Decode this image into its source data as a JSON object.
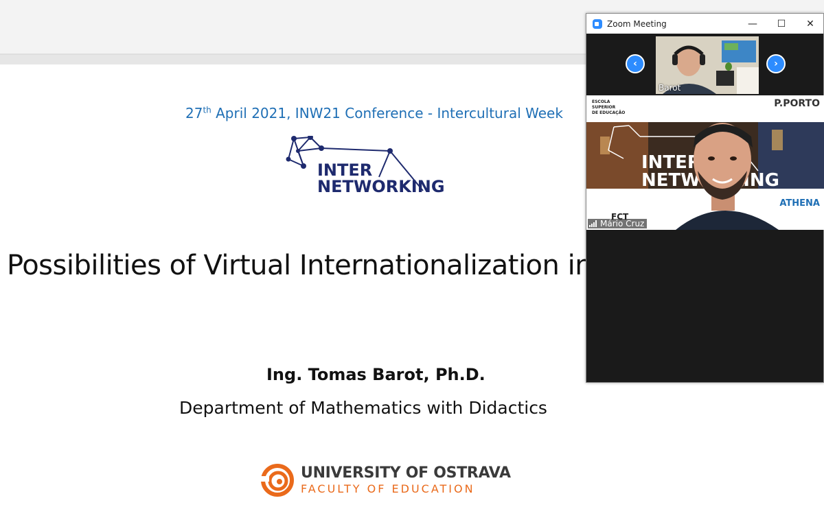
{
  "slide": {
    "conference_ordinal_number": "27",
    "conference_ordinal_suffix": "th",
    "conference_rest": " April 2021, INW21 Conference - Intercultural Week",
    "logo_line1": "INTER",
    "logo_line2": "NETWORKING",
    "title": "Possibilities of Virtual Internationalization in",
    "author": "Ing. Tomas Barot, Ph.D.",
    "department": "Department of Mathematics with Didactics",
    "university_name": "UNIVERSITY OF OSTRAVA",
    "faculty_name": "FACULTY OF EDUCATION"
  },
  "zoom": {
    "window_title": "Zoom Meeting",
    "minimize_glyph": "—",
    "maximize_glyph": "☐",
    "close_glyph": "✕",
    "prev_glyph": "‹",
    "next_glyph": "›",
    "thumbnail_name": "Barot",
    "main_name": "Mário Cruz",
    "banner": {
      "escola": "ESCOLA\nSUPERIOR\nDE EDUCAÇÃO",
      "porto": "P.PORTO",
      "athena": "ATHENA",
      "fct": "FCT",
      "title_line1": "INTER",
      "title_line2": "NETWORKING"
    }
  },
  "colors": {
    "conference_blue": "#1f6fb5",
    "logo_navy": "#1e2a6e",
    "zoom_blue": "#2d8cff",
    "ostrava_orange": "#ea6a1b"
  }
}
